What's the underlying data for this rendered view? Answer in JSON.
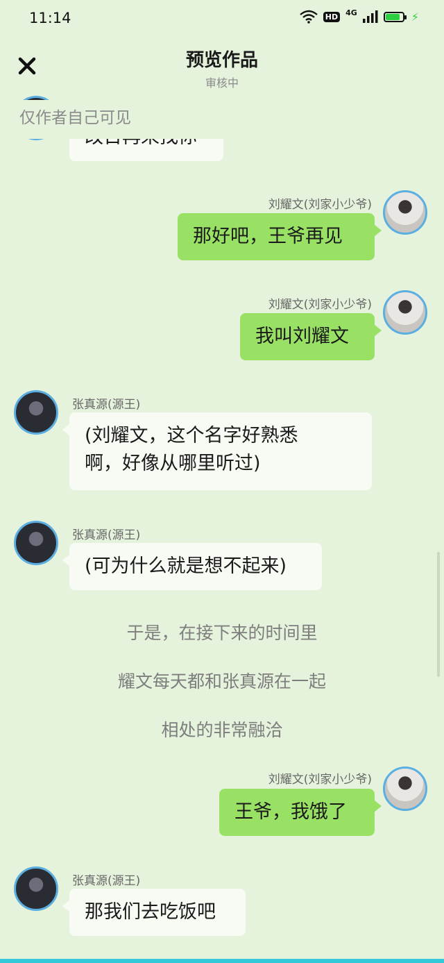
{
  "status_bar": {
    "time": "11:14",
    "hd": "HD",
    "network": "4G",
    "battery_level": 0.76
  },
  "header": {
    "title": "预览作品",
    "subtitle": "审核中",
    "close_icon": "close-icon"
  },
  "notice": "仅作者自己可见",
  "chat": {
    "partial_bubble": "改日再来找你",
    "messages": [
      {
        "side": "right",
        "name": "刘耀文(刘家小少爷)",
        "text": "那好吧，王爷再见",
        "avatar": "light"
      },
      {
        "side": "right",
        "name": "刘耀文(刘家小少爷)",
        "text": "我叫刘耀文",
        "avatar": "light"
      },
      {
        "side": "left",
        "name": "张真源(源王)",
        "lines": [
          "(刘耀文，这个名字好熟悉",
          "啊，好像从哪里听过)"
        ],
        "avatar": "dark"
      },
      {
        "side": "left",
        "name": "张真源(源王)",
        "text": "(可为什么就是想不起来)",
        "avatar": "dark"
      },
      {
        "side": "right",
        "name": "刘耀文(刘家小少爷)",
        "text": "王爷，我饿了",
        "avatar": "light"
      },
      {
        "side": "left",
        "name": "张真源(源王)",
        "text": "那我们去吃饭吧",
        "avatar": "dark"
      }
    ],
    "narration": [
      "于是，在接下来的时间里",
      "耀文每天都和张真源在一起",
      "相处的非常融洽"
    ]
  },
  "colors": {
    "background": "#e6f3dc",
    "right_bubble": "#98e165",
    "left_bubble": "#f7fbf4",
    "avatar_ring": "#5aaee0"
  }
}
